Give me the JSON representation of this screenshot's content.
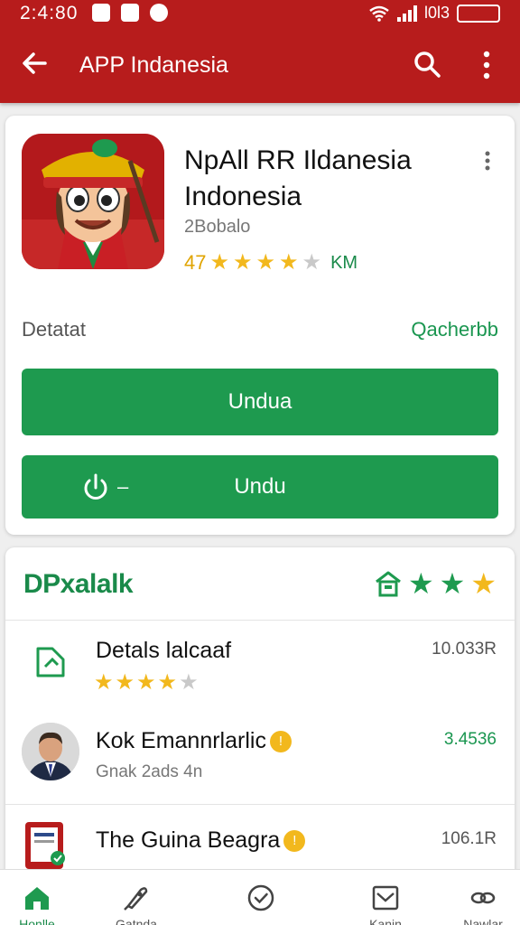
{
  "status_bar": {
    "time": "2:4:80",
    "network": "l0l3"
  },
  "app_bar": {
    "title": "APP Indanesia"
  },
  "app": {
    "name_line1": "NpAll RR Ildanesia",
    "name_line2": "Indonesia",
    "developer": "2Bobalo",
    "rating": "47",
    "rating_stars": 4,
    "rating_suffix": "KM"
  },
  "details": {
    "label": "Detatat",
    "link": "Qacherbb"
  },
  "buttons": {
    "install_label": "Undua",
    "open_label": "Undu",
    "open_dash": "–"
  },
  "section": {
    "title": "DPxalalk",
    "header_stars": 3
  },
  "list": [
    {
      "title": "Detals lalcaaf",
      "value": "10.033R",
      "stars": 4
    },
    {
      "title": "Kok Emannrlarlic",
      "subtitle": "Gnak 2ads 4n",
      "value": "3.4536",
      "badge": "!"
    },
    {
      "title": "The Guina Beagra",
      "value": "106.1R",
      "badge": "!"
    }
  ],
  "bottom_nav": [
    {
      "label": "Honlle",
      "active": true
    },
    {
      "label": "Gatnda",
      "active": false
    },
    {
      "label": "",
      "active": false
    },
    {
      "label": "Kanin",
      "active": false
    },
    {
      "label": "Nawlar",
      "active": false
    }
  ],
  "colors": {
    "primary": "#b71c1c",
    "accent_green": "#1e9a4f",
    "star": "#f2b81d"
  }
}
